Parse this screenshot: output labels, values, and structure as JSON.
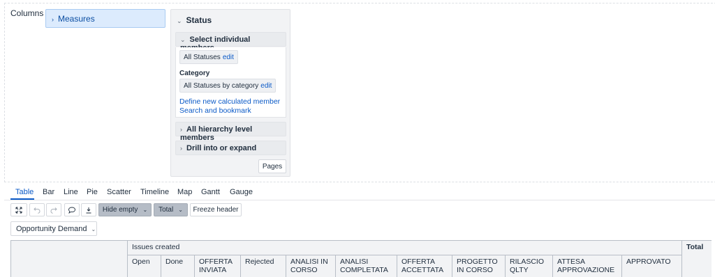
{
  "layout_area": {
    "columns_label": "Columns",
    "measures_chip": "Measures"
  },
  "status_panel": {
    "title": "Status",
    "select_members_header": "Select individual members",
    "all_statuses": "All Statuses",
    "edit_label": "edit",
    "category_label": "Category",
    "all_statuses_by_category": "All Statuses by category",
    "define_calc_member": "Define new calculated member",
    "search_bookmark": "Search and bookmark",
    "all_hierarchy_level": "All hierarchy level members",
    "drill_expand": "Drill into or expand",
    "pages_button": "Pages"
  },
  "view_tabs": [
    "Table",
    "Bar",
    "Line",
    "Pie",
    "Scatter",
    "Timeline",
    "Map",
    "Gantt",
    "Gauge"
  ],
  "active_tab": "Table",
  "toolbar": {
    "hide_empty": "Hide empty",
    "total": "Total",
    "freeze_header": "Freeze header"
  },
  "page_filter": "Opportunity Demand",
  "table": {
    "group_header": "Issues created",
    "total_header": "Total",
    "columns": [
      "Open",
      "Done",
      "OFFERTA INVIATA",
      "Rejected",
      "ANALISI IN CORSO",
      "ANALISI COMPLETATA",
      "OFFERTA ACCETTATA",
      "PROGETTO IN CORSO",
      "RILASCIO QLTY",
      "ATTESA APPROVAZIONE",
      "APPROVATO"
    ]
  },
  "icons": {
    "expand": "expand-arrows-icon",
    "undo": "undo-icon",
    "redo": "redo-icon",
    "comment": "comment-icon",
    "export": "download-icon"
  }
}
